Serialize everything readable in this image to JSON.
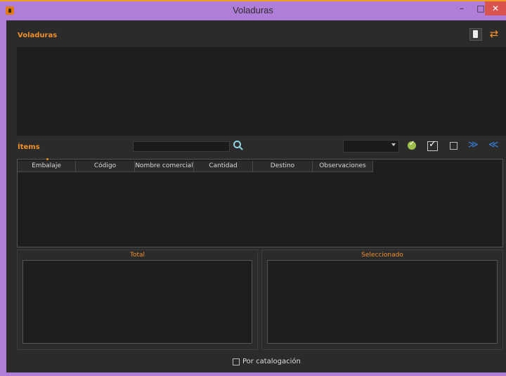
{
  "window": {
    "title": "Voladuras"
  },
  "voladuras": {
    "label": "Voladuras"
  },
  "items": {
    "label": "Ítems",
    "search_value": "",
    "dropdown_value": "",
    "columns": [
      "Embalaje",
      "Código",
      "Nombre comercial",
      "Cantidad",
      "Destino",
      "Observaciones"
    ]
  },
  "total": {
    "label": "Total"
  },
  "selected": {
    "label": "Seleccionado"
  },
  "catalog": {
    "label": "Por catalogación"
  },
  "colors": {
    "accent": "#f0902a",
    "frame": "#b07ed8",
    "background": "#2b2b2b"
  }
}
